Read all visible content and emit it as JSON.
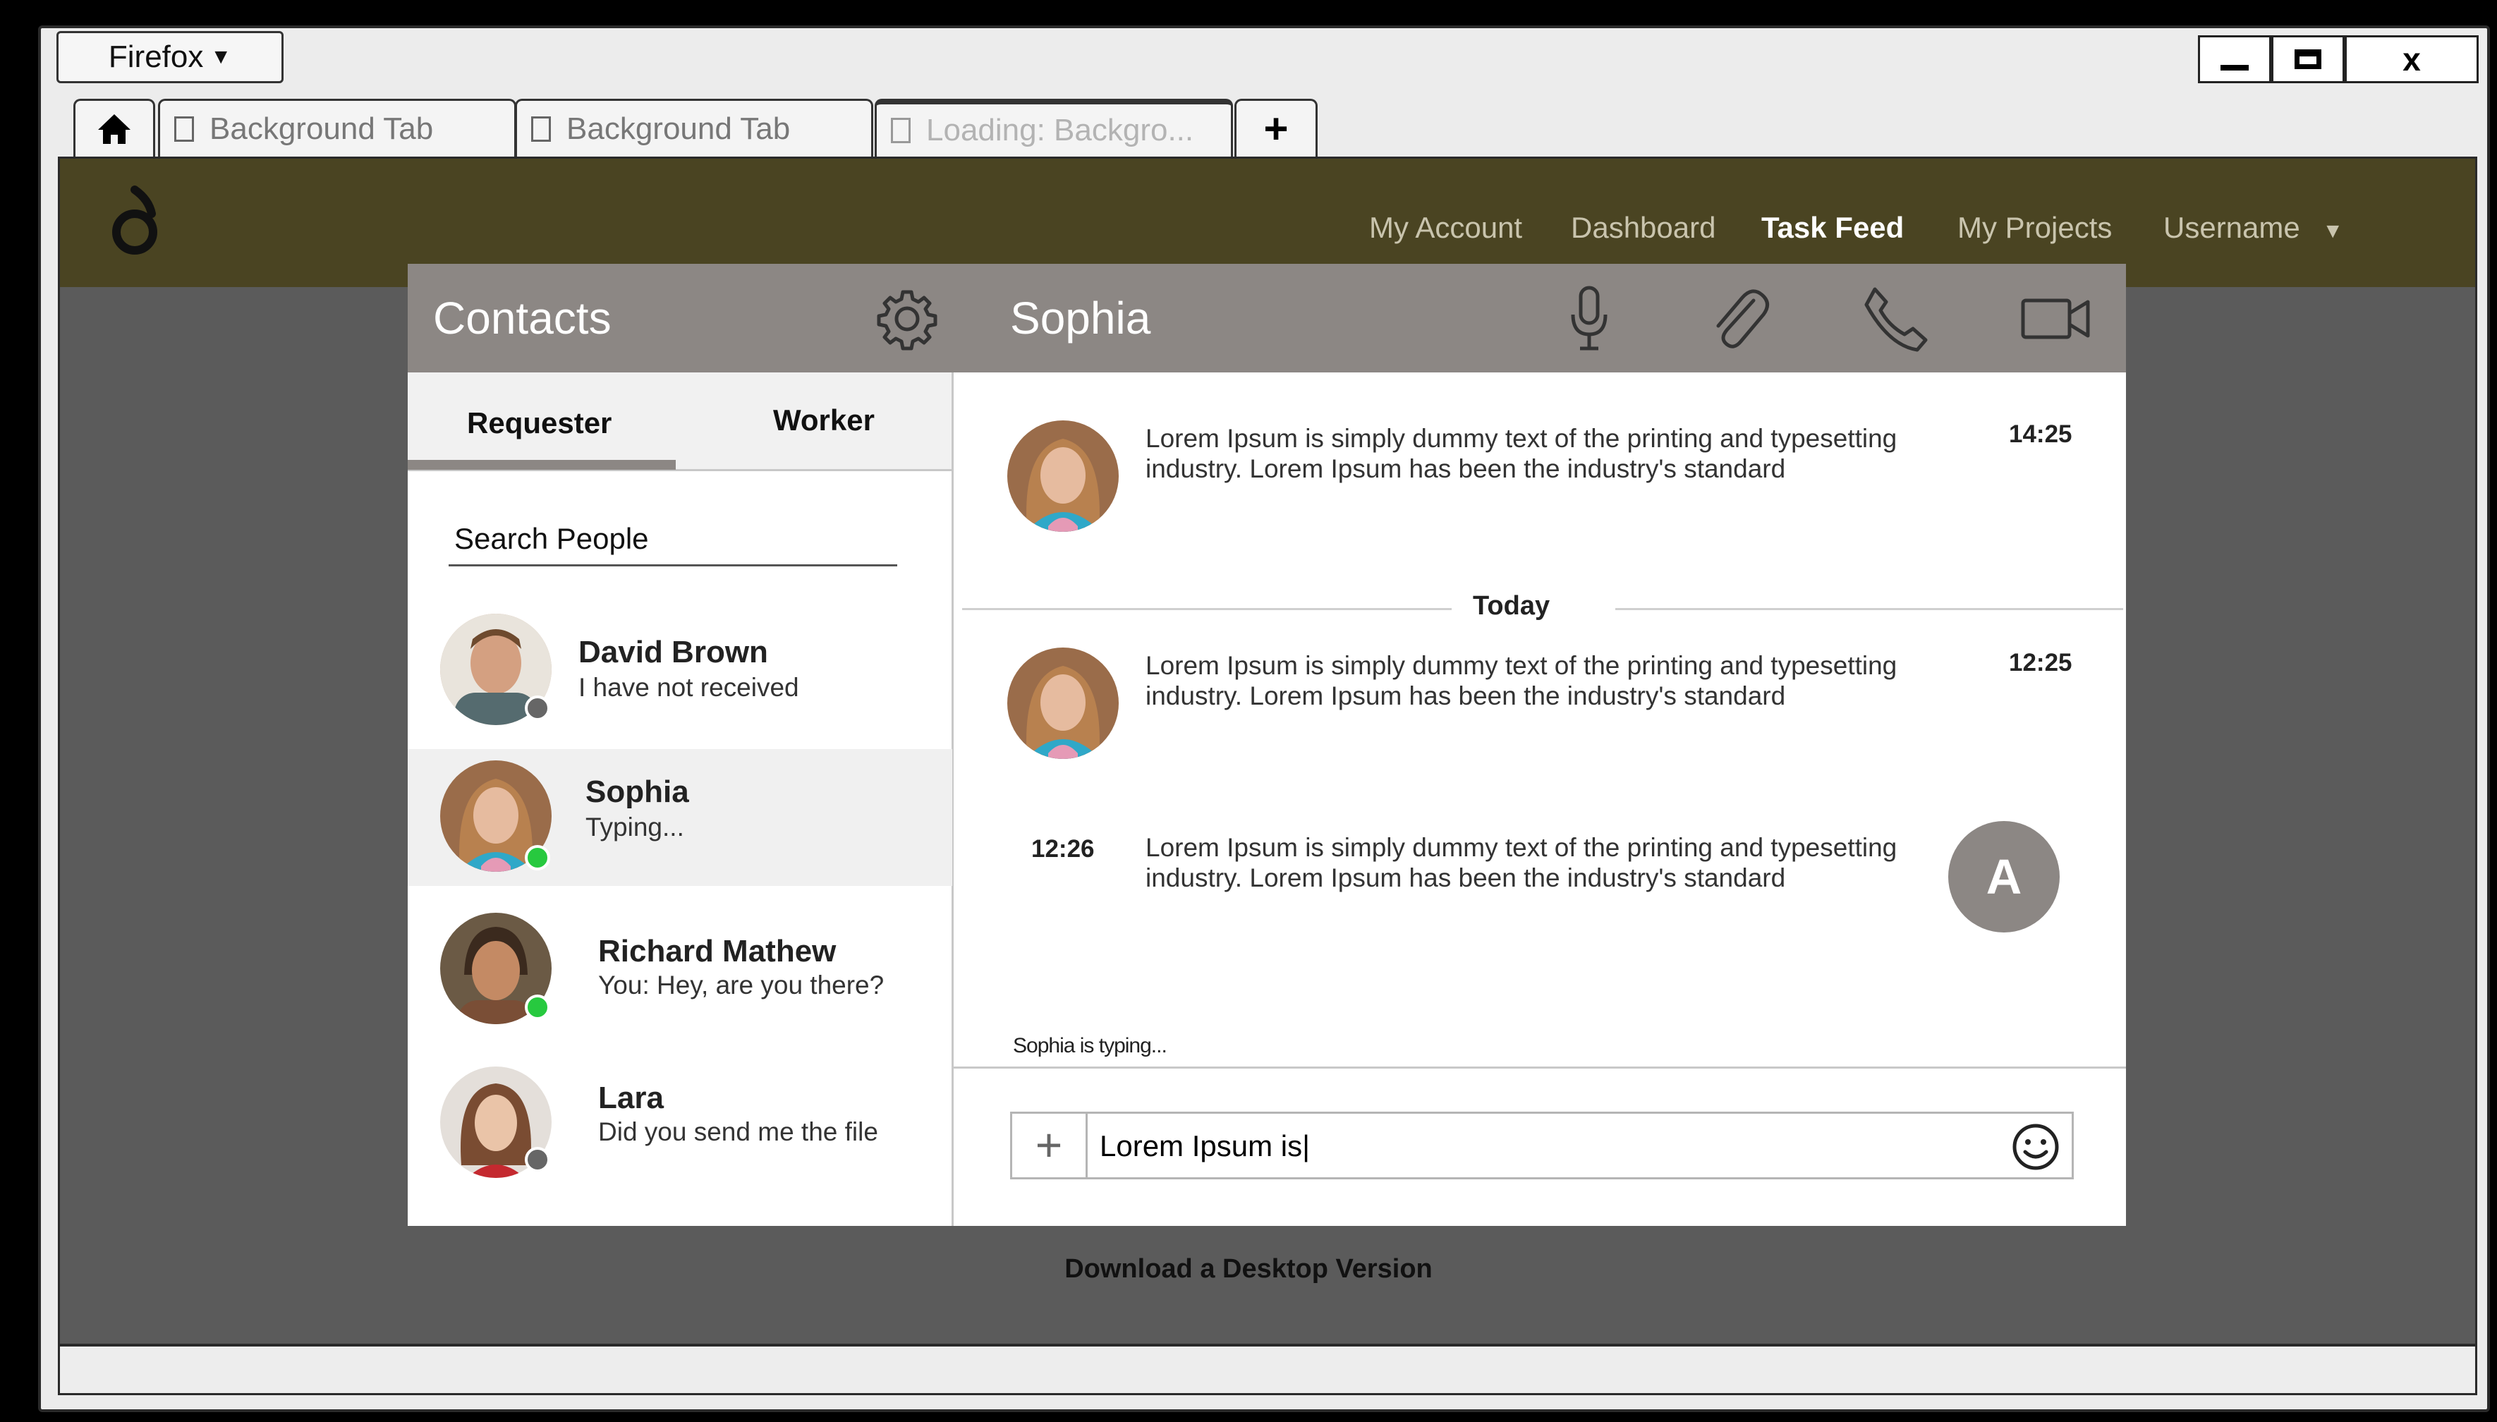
{
  "browser": {
    "menu_label": "Firefox",
    "window_controls": [
      "_",
      "□",
      "x"
    ],
    "tabs": [
      {
        "label": "Background Tab"
      },
      {
        "label": "Background Tab"
      },
      {
        "label": "Loading: Backgro..."
      }
    ],
    "new_tab_label": "+"
  },
  "site": {
    "nav": [
      "My Account",
      "Dashboard",
      "Task Feed",
      "My Projects"
    ],
    "active_nav": "Task Feed",
    "username": "Username",
    "footer_link": "Download a Desktop Version",
    "colors": {
      "topbar": "#4a4422",
      "background": "#5b5b5b"
    }
  },
  "contacts": {
    "title": "Contacts",
    "tabs": {
      "requester": "Requester",
      "worker": "Worker"
    },
    "search_placeholder": "Search People",
    "list": [
      {
        "name": "David Brown",
        "message": "I have not received",
        "status": "offline"
      },
      {
        "name": "Sophia",
        "message": "Typing...",
        "status": "online"
      },
      {
        "name": "Richard Mathew",
        "message": "You: Hey, are you there?",
        "status": "online"
      },
      {
        "name": "Lara",
        "message": "Did you send me the file",
        "status": "offline"
      }
    ]
  },
  "chat": {
    "title": "Sophia",
    "icons": [
      "microphone-icon",
      "paperclip-icon",
      "phone-icon",
      "video-camera-icon"
    ],
    "messages": [
      {
        "from": "Sophia",
        "text": "Lorem Ipsum is simply dummy text of the printing and typesetting industry. Lorem Ipsum has been the industry's standard",
        "time": "14:25"
      },
      {
        "from": "Sophia",
        "text": "Lorem Ipsum is simply dummy text of the printing and typesetting industry. Lorem Ipsum has been the industry's standard",
        "time": "12:25"
      },
      {
        "from": "me",
        "text": "Lorem Ipsum is simply dummy text of the printing and typesetting industry. Lorem Ipsum has been the industry's standard",
        "time": "12:26",
        "avatar_letter": "A"
      }
    ],
    "divider": "Today",
    "typing_indicator": "Sophia is typing...",
    "input_value": "Lorem Ipsum is|",
    "add_label": "+"
  }
}
